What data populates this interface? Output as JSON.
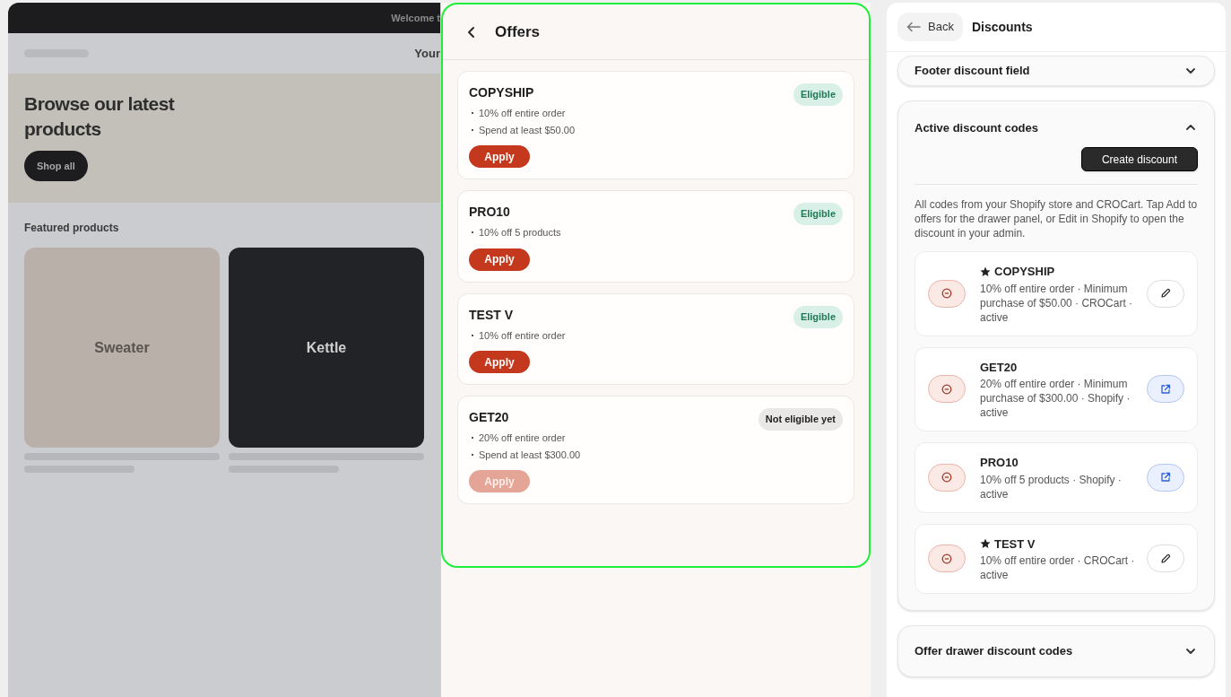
{
  "storefront": {
    "announcement": "Welcome t",
    "nav_link": "Your",
    "hero": {
      "title": "Browse our latest products",
      "button": "Shop all"
    },
    "section_title": "Featured products",
    "products": [
      {
        "name": "Sweater",
        "color": "#b9b0aa"
      },
      {
        "name": "Kettle",
        "color": "#222326"
      }
    ]
  },
  "drawer": {
    "title": "Offers",
    "offers": [
      {
        "code": "COPYSHIP",
        "details": [
          "10% off entire order",
          "Spend at least $50.00"
        ],
        "badge": "Eligible",
        "eligible": true,
        "button": "Apply"
      },
      {
        "code": "PRO10",
        "details": [
          "10% off 5 products"
        ],
        "badge": "Eligible",
        "eligible": true,
        "button": "Apply"
      },
      {
        "code": "TEST V",
        "details": [
          "10% off entire order"
        ],
        "badge": "Eligible",
        "eligible": true,
        "button": "Apply"
      },
      {
        "code": "GET20",
        "details": [
          "20% off entire order",
          "Spend at least $300.00"
        ],
        "badge": "Not eligible yet",
        "eligible": false,
        "button": "Apply"
      }
    ]
  },
  "panel": {
    "back": "Back",
    "title": "Discounts",
    "sections": [
      {
        "title": "Footer discount field",
        "expanded": false
      },
      {
        "title": "Active discount codes",
        "expanded": true,
        "create_button": "Create discount",
        "description": "All codes from your Shopify store and CROCart. Tap Add to offers for the drawer panel, or Edit in Shopify to open the discount in your admin.",
        "codes": [
          {
            "code": "COPYSHIP",
            "starred": true,
            "description": "10% off entire order · Minimum purchase of $50.00 · CROCart · active",
            "kind": "edit"
          },
          {
            "code": "GET20",
            "starred": false,
            "description": "20% off entire order · Minimum purchase of $300.00 · Shopify · active",
            "kind": "open"
          },
          {
            "code": "PRO10",
            "starred": false,
            "description": "10% off 5 products · Shopify · active",
            "kind": "open"
          },
          {
            "code": "TEST V",
            "starred": true,
            "description": "10% off entire order · CROCart · active",
            "kind": "edit"
          }
        ]
      },
      {
        "title": "Offer drawer discount codes",
        "expanded": false
      }
    ]
  }
}
